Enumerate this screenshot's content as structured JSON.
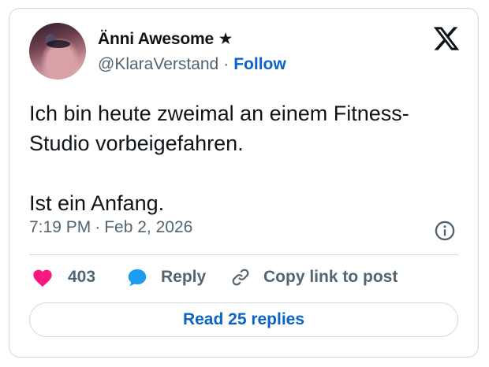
{
  "author": {
    "display_name": "Änni Awesome ★",
    "handle": "@KlaraVerstand",
    "separator": "·",
    "follow_label": "Follow",
    "avatar_icon": "profile-photo"
  },
  "tweet": {
    "lines": [
      "Ich bin heute zweimal an einem Fitness-",
      "Studio vorbeigefahren."
    ],
    "paragraph2": "Ist ein Anfang.",
    "time": "7:19 PM",
    "date": "Feb 2, 2026",
    "separator": "·"
  },
  "actions": {
    "like_count": "403",
    "reply_label": "Reply",
    "copy_label": "Copy link to post"
  },
  "read_replies_label": "Read 25 replies",
  "icons": {
    "brand": "x-logo-icon",
    "info": "info-icon",
    "like": "heart-icon",
    "reply": "speech-bubble-icon",
    "copy": "link-icon"
  },
  "colors": {
    "like": "#f91880",
    "reply": "#1d9bf0",
    "link": "#0a63c8",
    "secondary_text": "#536471",
    "border": "#cfd9de"
  }
}
